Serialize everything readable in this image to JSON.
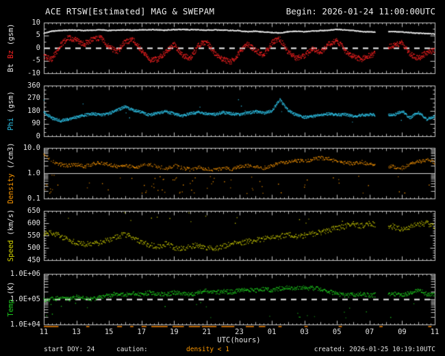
{
  "header": {
    "title": "ACE RTSW[Estimated] MAG & SWEPAM",
    "begin": "Begin: 2026-01-24 11:00:00UTC"
  },
  "footer": {
    "start_doy": "start DOY:  24",
    "caution_label": "caution:",
    "caution_value": "density < 1",
    "created": "created: 2026-01-25 10:19:10UTC"
  },
  "colors": {
    "background": "#000000",
    "frame": "#c9c9c9",
    "text": "#e2e2e2",
    "bt": "#ededed",
    "bz": "#ff2222",
    "phi": "#2ec1e6",
    "density": "#ff9900",
    "speed": "#d6d600",
    "temp": "#1ecb1e",
    "caution_marks": "#bb6600",
    "refline": "#f5f5f5"
  },
  "chart_data": {
    "type": "scatter",
    "title": "ACE RTSW[Estimated] MAG & SWEPAM",
    "xlabel": "UTC(hours)",
    "x_hours_start": 11,
    "x_hours_end": 35,
    "trend_step_hours": 0.5,
    "grid": false,
    "x_ticks": [
      {
        "hour": 11,
        "label": "11"
      },
      {
        "hour": 13,
        "label": "13"
      },
      {
        "hour": 15,
        "label": "15"
      },
      {
        "hour": 17,
        "label": "17"
      },
      {
        "hour": 19,
        "label": "19"
      },
      {
        "hour": 21,
        "label": "21"
      },
      {
        "hour": 23,
        "label": "23"
      },
      {
        "hour": 25,
        "label": "01"
      },
      {
        "hour": 27,
        "label": "03"
      },
      {
        "hour": 29,
        "label": "05"
      },
      {
        "hour": 31,
        "label": "07"
      },
      {
        "hour": 33,
        "label": "09"
      },
      {
        "hour": 35,
        "label": "11"
      }
    ],
    "gaps": [
      [
        31.35,
        32.15
      ]
    ],
    "caution_ranges": [
      [
        11.0,
        11.9
      ],
      [
        13.6,
        13.8
      ],
      [
        15.5,
        15.8
      ],
      [
        16.3,
        16.5
      ],
      [
        17.0,
        17.3
      ],
      [
        17.6,
        18.6
      ],
      [
        18.9,
        19.6
      ],
      [
        19.9,
        20.6
      ],
      [
        20.7,
        21.6
      ],
      [
        21.9,
        22.7
      ],
      [
        23.4,
        23.9
      ],
      [
        24.2,
        24.6
      ],
      [
        25.4,
        25.6
      ],
      [
        27.0,
        27.2
      ],
      [
        29.1,
        29.3
      ],
      [
        31.6,
        31.8
      ],
      [
        34.6,
        34.8
      ]
    ],
    "panels": [
      {
        "name": "bt-bz",
        "scale": "linear",
        "ylim": [
          -10,
          10
        ],
        "minor_step": 2.5,
        "major_step": 5,
        "yticks": [
          {
            "v": 10,
            "label": "10"
          },
          {
            "v": 5,
            "label": "5"
          },
          {
            "v": 0,
            "label": "0"
          },
          {
            "v": -5,
            "label": "-5"
          },
          {
            "v": -10,
            "label": "-10"
          }
        ],
        "ylabel_parts": [
          {
            "text": "Bt",
            "color": "#ededed"
          },
          {
            "text": "Bz",
            "color": "#ff2222"
          },
          {
            "text": "(gsm)",
            "color": "#ededed"
          }
        ],
        "reflines": [
          {
            "v": 0,
            "style": "dashed"
          }
        ],
        "series": [
          {
            "name": "Bt",
            "color": "#ededed",
            "step_min": 1,
            "jitter": 0.18,
            "trend": [
              5.8,
              6.6,
              6.9,
              7.0,
              7.0,
              6.9,
              7.0,
              7.1,
              6.9,
              7.0,
              7.1,
              7.0,
              7.1,
              7.2,
              7.1,
              7.0,
              7.2,
              7.3,
              7.2,
              7.1,
              7.0,
              7.1,
              7.0,
              6.9,
              6.8,
              6.4,
              6.6,
              6.3,
              6.1,
              5.9,
              6.4,
              6.6,
              6.4,
              6.7,
              6.8,
              7.0,
              7.3,
              7.1,
              6.8,
              6.5,
              6.3,
              6.3,
              6.4,
              6.4,
              6.3,
              6.0,
              5.8,
              5.7,
              5.5
            ]
          },
          {
            "name": "Bz",
            "color": "#ff2222",
            "step_min": 1,
            "jitter": 1.1,
            "trend": [
              -3.5,
              -4.5,
              1.0,
              4.0,
              3.0,
              1.5,
              3.5,
              4.0,
              0.5,
              -1.5,
              2.5,
              3.0,
              -1.0,
              -5.0,
              -4.5,
              -1.5,
              1.5,
              -3.0,
              -4.0,
              1.0,
              2.5,
              -2.0,
              -4.5,
              -5.5,
              -2.0,
              1.5,
              -1.0,
              -3.0,
              2.0,
              3.5,
              -1.5,
              -4.0,
              -3.0,
              -0.5,
              -2.0,
              1.5,
              3.0,
              -1.0,
              -3.5,
              -4.5,
              -3.0,
              -2.0,
              0.0,
              1.0,
              2.0,
              -2.5,
              -4.0,
              -2.0,
              -1.0
            ]
          }
        ]
      },
      {
        "name": "phi",
        "scale": "linear",
        "ylim": [
          0,
          360
        ],
        "minor_step": 30,
        "major_step": 90,
        "yticks": [
          {
            "v": 360,
            "label": "360"
          },
          {
            "v": 270,
            "label": "270"
          },
          {
            "v": 180,
            "label": "180"
          },
          {
            "v": 90,
            "label": "90"
          },
          {
            "v": 0,
            "label": "0"
          }
        ],
        "ylabel_parts": [
          {
            "text": "Phi",
            "color": "#2ec1e6"
          },
          {
            "text": "(gsm)",
            "color": "#ededed"
          }
        ],
        "reflines": [],
        "series": [
          {
            "name": "Phi",
            "color": "#2ec1e6",
            "step_min": 1,
            "jitter": 10,
            "outliers": {
              "prob": 0.01,
              "vmin": 70,
              "vmax": 260
            },
            "trend": [
              170,
              130,
              110,
              120,
              135,
              150,
              160,
              150,
              160,
              185,
              210,
              185,
              170,
              150,
              165,
              175,
              160,
              145,
              160,
              170,
              160,
              155,
              170,
              160,
              155,
              165,
              175,
              165,
              180,
              260,
              185,
              150,
              135,
              140,
              150,
              160,
              150,
              155,
              140,
              150,
              155,
              150,
              150,
              150,
              180,
              130,
              170,
              120,
              140
            ]
          }
        ]
      },
      {
        "name": "density",
        "scale": "log",
        "ylim": [
          0.1,
          10
        ],
        "yticks": [
          {
            "v": 10,
            "label": "10.0"
          },
          {
            "v": 1,
            "label": "1.0"
          },
          {
            "v": 0.1,
            "label": "0.1"
          }
        ],
        "ylabel_parts": [
          {
            "text": "Density",
            "color": "#ff9900"
          },
          {
            "text": "(/cm3)",
            "color": "#ededed"
          }
        ],
        "reflines": [
          {
            "v": 1,
            "style": "solid"
          }
        ],
        "series": [
          {
            "name": "Density",
            "color": "#ff9900",
            "step_min": 2,
            "jitter_log": 0.07,
            "outliers": {
              "prob": 0.015,
              "vmin": 0.15,
              "vmax": 0.85,
              "boost_in_caution": 0.28
            },
            "trend": [
              5.0,
              3.0,
              2.2,
              2.0,
              2.2,
              1.8,
              2.3,
              2.5,
              2.2,
              1.8,
              2.2,
              1.6,
              2.0,
              2.2,
              1.8,
              1.5,
              2.0,
              1.6,
              1.4,
              1.7,
              1.5,
              1.3,
              1.6,
              1.4,
              1.8,
              2.0,
              1.7,
              1.6,
              2.0,
              2.4,
              2.8,
              3.2,
              3.0,
              3.5,
              4.0,
              3.6,
              3.0,
              2.6,
              2.4,
              2.8,
              2.2,
              2.0,
              1.9,
              1.8,
              1.6,
              2.2,
              2.8,
              3.4,
              2.6
            ]
          }
        ]
      },
      {
        "name": "speed",
        "scale": "linear",
        "ylim": [
          450,
          650
        ],
        "minor_step": 10,
        "major_step": 50,
        "yticks": [
          {
            "v": 650,
            "label": "650"
          },
          {
            "v": 600,
            "label": "600"
          },
          {
            "v": 550,
            "label": "550"
          },
          {
            "v": 500,
            "label": "500"
          },
          {
            "v": 450,
            "label": "450"
          }
        ],
        "ylabel_parts": [
          {
            "text": "Speed",
            "color": "#d6d600"
          },
          {
            "text": "(km/s)",
            "color": "#ededed"
          }
        ],
        "reflines": [],
        "series": [
          {
            "name": "Speed",
            "color": "#d6d600",
            "step_min": 2,
            "jitter": 11,
            "outliers": {
              "prob": 0.02,
              "vmin": 598,
              "vmax": 645
            },
            "trend": [
              555,
              560,
              548,
              532,
              520,
              515,
              515,
              522,
              532,
              545,
              555,
              540,
              522,
              512,
              506,
              515,
              502,
              495,
              505,
              512,
              500,
              495,
              506,
              515,
              520,
              526,
              530,
              536,
              540,
              546,
              552,
              546,
              550,
              556,
              562,
              572,
              580,
              588,
              598,
              588,
              598,
              592,
              588,
              585,
              572,
              585,
              595,
              600,
              588
            ]
          }
        ]
      },
      {
        "name": "temp",
        "scale": "log",
        "ylim": [
          10000,
          1000000
        ],
        "yticks": [
          {
            "v": 1000000,
            "label": "1.0E+06"
          },
          {
            "v": 100000,
            "label": "1.0E+05"
          },
          {
            "v": 10000,
            "label": "1.0E+04"
          }
        ],
        "ylabel_parts": [
          {
            "text": "Temp",
            "color": "#1ecb1e"
          },
          {
            "text": "(K)",
            "color": "#ededed"
          }
        ],
        "reflines": [
          {
            "v": 100000,
            "style": "dashed"
          }
        ],
        "series": [
          {
            "name": "Temp",
            "color": "#1ecb1e",
            "step_min": 1.5,
            "jitter_log": 0.085,
            "outliers": {
              "prob": 0.022,
              "vmin": 18000,
              "vmax": 75000
            },
            "trend": [
              90000,
              100000,
              110000,
              100000,
              120000,
              110000,
              100000,
              120000,
              140000,
              160000,
              150000,
              170000,
              150000,
              180000,
              160000,
              150000,
              180000,
              170000,
              150000,
              190000,
              210000,
              180000,
              200000,
              190000,
              220000,
              240000,
              220000,
              250000,
              230000,
              260000,
              280000,
              260000,
              280000,
              270000,
              250000,
              200000,
              160000,
              140000,
              150000,
              160000,
              140000,
              150000,
              155000,
              160000,
              140000,
              180000,
              220000,
              160000,
              150000
            ]
          }
        ]
      }
    ]
  }
}
